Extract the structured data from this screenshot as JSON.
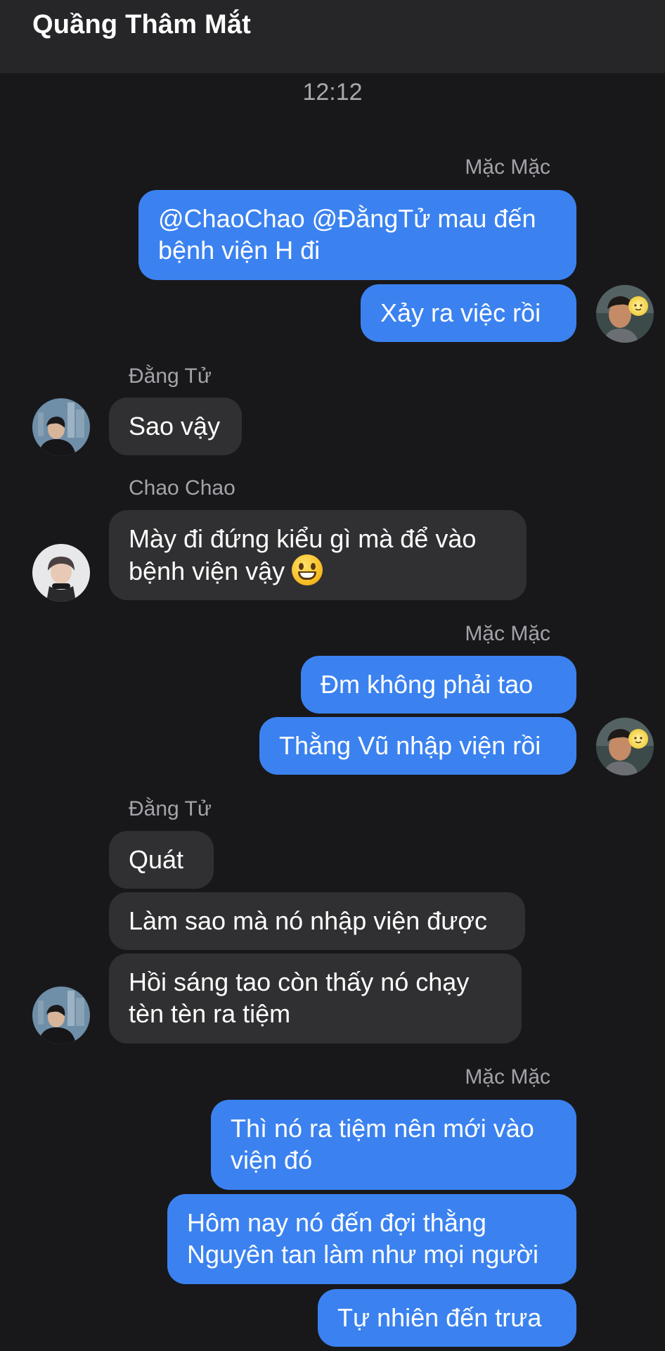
{
  "chat": {
    "title": "Quầng Thâm Mắt"
  },
  "timestamp": "12:12",
  "senders": {
    "mac_mac": "Mặc Mặc",
    "dang_tu": "Đằng Tử",
    "chao_chao": "Chao Chao"
  },
  "messages": {
    "m1": "@ChaoChao @ĐằngTử mau đến",
    "m1b": "bệnh viện H đi",
    "m2": "Xảy ra việc rồi",
    "m3": "Sao vậy",
    "m4a": "Mày đi đứng kiểu gì mà để vào",
    "m4b": "bệnh viện vậy",
    "m5": "Đm không phải tao",
    "m6": "Thằng Vũ nhập viện rồi",
    "m7": "Quát",
    "m8": "Làm sao mà nó nhập viện được",
    "m9a": "Hồi sáng tao còn thấy nó chạy",
    "m9b": "tèn tèn ra tiệm",
    "m10a": "Thì nó ra tiệm nên mới vào",
    "m10b": "viện đó",
    "m11a": "Hôm nay nó đến đợi thằng",
    "m11b": "Nguyên tan làm như mọi người",
    "m12": "Tự nhiên đến trưa"
  },
  "icons": {
    "grinning_emoji": "grinning-face-emoji",
    "avatar_mac_mac": "avatar-boy-with-sun-sticker",
    "avatar_dang_tu": "avatar-boy-city-background",
    "avatar_chao_chao": "avatar-boy-white-background"
  },
  "colors": {
    "background": "#18181b",
    "header": "#262628",
    "outgoing_bubble": "#3b82f0",
    "incoming_bubble": "#303032",
    "sender_name": "#a3a3a9"
  }
}
